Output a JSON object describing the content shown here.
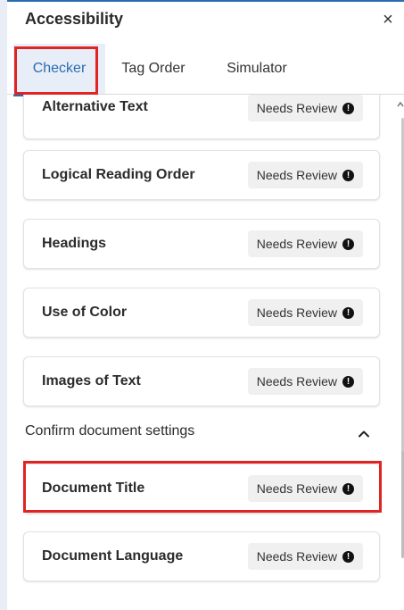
{
  "panel": {
    "title": "Accessibility",
    "close_symbol": "×"
  },
  "tabs": [
    {
      "label": "Checker",
      "active": true
    },
    {
      "label": "Tag Order",
      "active": false
    },
    {
      "label": "Simulator",
      "active": false
    }
  ],
  "status_icon_symbol": "!",
  "cards": [
    {
      "label": "Alternative Text",
      "status": "Needs Review"
    },
    {
      "label": "Logical Reading Order",
      "status": "Needs Review"
    },
    {
      "label": "Headings",
      "status": "Needs Review"
    },
    {
      "label": "Use of Color",
      "status": "Needs Review"
    },
    {
      "label": "Images of Text",
      "status": "Needs Review"
    }
  ],
  "document_settings": {
    "header": "Confirm document settings",
    "expanded": true,
    "cards": [
      {
        "label": "Document Title",
        "status": "Needs Review"
      },
      {
        "label": "Document Language",
        "status": "Needs Review"
      }
    ]
  },
  "colors": {
    "accent": "#2b6cb0",
    "highlight": "#e02424",
    "badge_bg": "#f0f0f0"
  }
}
